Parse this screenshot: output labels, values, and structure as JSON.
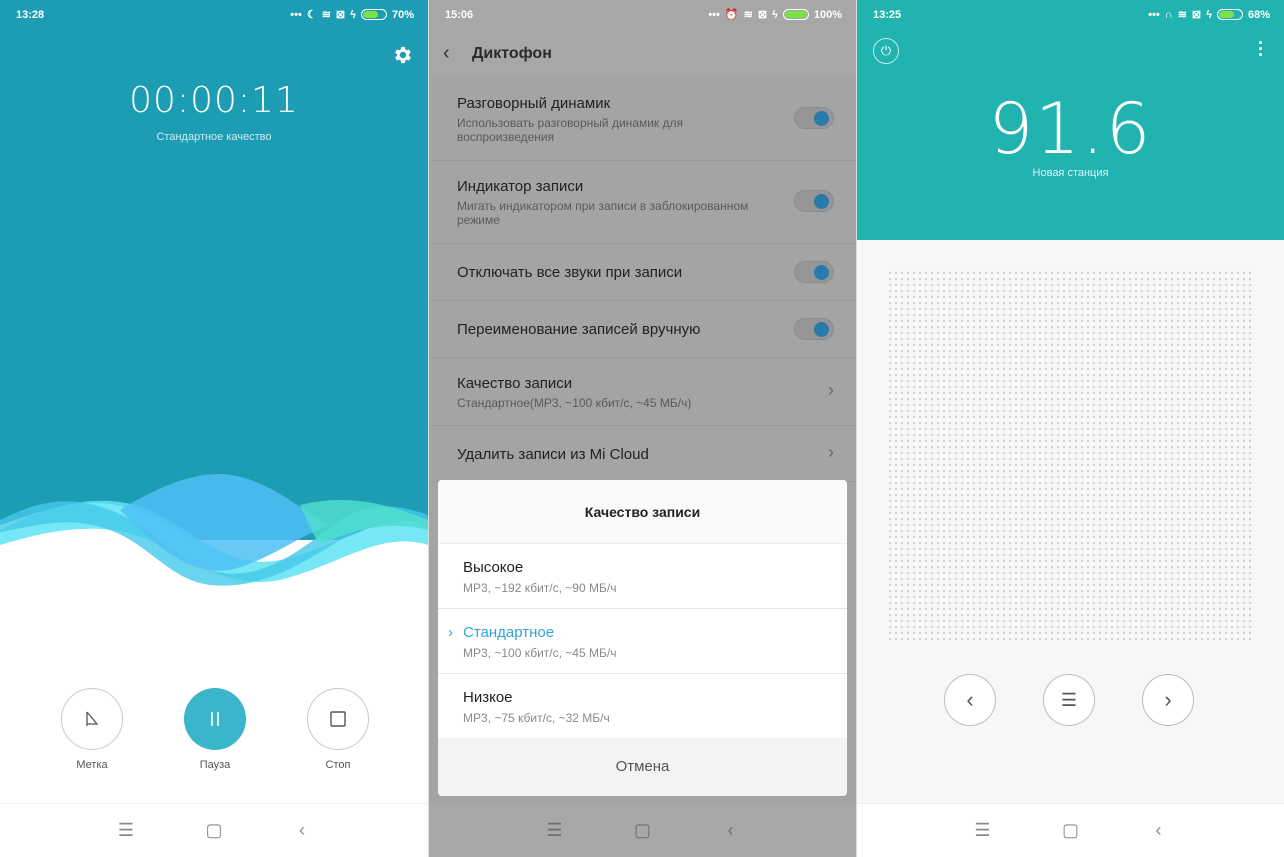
{
  "recorder": {
    "status": {
      "time": "13:28",
      "battery": "70%"
    },
    "timer": "00:00:11",
    "quality": "Стандартное качество",
    "controls": {
      "mark": "Метка",
      "pause": "Пауза",
      "stop": "Стоп"
    },
    "colors": {
      "accent": "#1c9db3",
      "pause_button": "#3ab5c9"
    }
  },
  "settings": {
    "status": {
      "time": "15:06",
      "battery": "100%"
    },
    "title": "Диктофон",
    "rows": [
      {
        "title": "Разговорный динамик",
        "subtitle": "Использовать разговорный динамик для воспроизведения",
        "toggle": true
      },
      {
        "title": "Индикатор записи",
        "subtitle": "Мигать индикатором при записи в заблокированном режиме",
        "toggle": true
      },
      {
        "title": "Отключать все звуки при записи",
        "subtitle": "",
        "toggle": true
      },
      {
        "title": "Переименование записей вручную",
        "subtitle": "",
        "toggle": true
      },
      {
        "title": "Качество записи",
        "subtitle": "Стандартное(MP3, ~100 кбит/с, ~45 МБ/ч)",
        "toggle": false
      },
      {
        "title": "Удалить записи из Mi Cloud",
        "subtitle": "",
        "toggle": false
      }
    ],
    "dialog": {
      "title": "Качество записи",
      "options": [
        {
          "label": "Высокое",
          "detail": "MP3, ~192 кбит/с, ~90 МБ/ч",
          "selected": false
        },
        {
          "label": "Стандартное",
          "detail": "MP3, ~100 кбит/с, ~45 МБ/ч",
          "selected": true
        },
        {
          "label": "Низкое",
          "detail": "MP3, ~75 кбит/с, ~32 МБ/ч",
          "selected": false
        }
      ],
      "cancel": "Отмена"
    }
  },
  "radio": {
    "status": {
      "time": "13:25",
      "battery": "68%"
    },
    "frequency": "91.6",
    "station": "Новая станция",
    "colors": {
      "accent": "#21b3b0"
    }
  },
  "icons": [
    "gear-icon",
    "mark-icon",
    "pause-icon",
    "stop-icon",
    "back-icon",
    "chevron-right-icon",
    "power-icon",
    "more-icon",
    "prev-icon",
    "list-icon",
    "next-icon",
    "nav-menu-icon",
    "nav-home-icon",
    "nav-back-icon"
  ]
}
